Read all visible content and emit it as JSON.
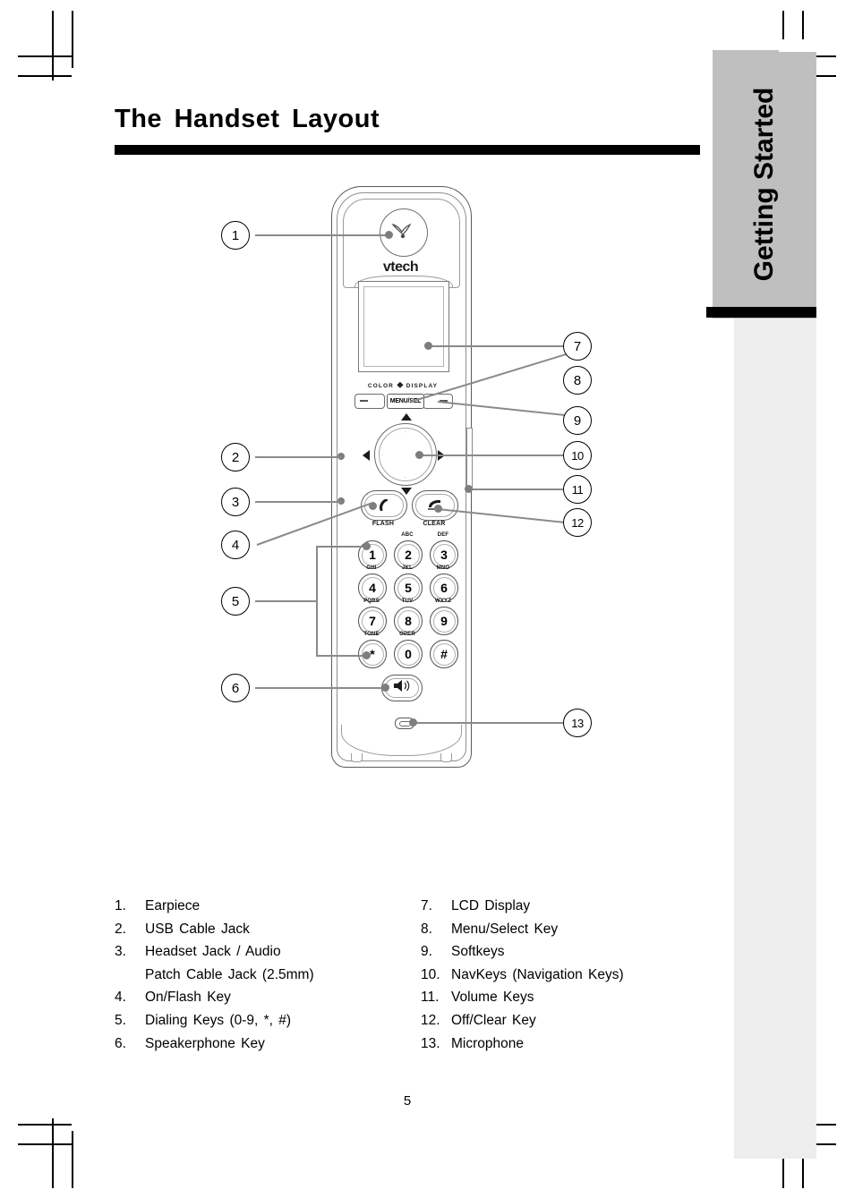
{
  "document": {
    "title": "The Handset Layout",
    "page_number": "5",
    "side_tab_label": "Getting Started"
  },
  "device": {
    "brand": "vtech",
    "display_label_prefix": "COLOR",
    "display_label_icon": "❖",
    "display_label_suffix": "DISPLAY",
    "menu_select_label": "MENU/SEL",
    "talk_key_cap": "FLASH",
    "off_key_cap": "CLEAR",
    "talk_key_glyph": "✆",
    "off_key_glyph": "✆",
    "speaker_glyph": "🔊",
    "earpiece_logo_glyph": "❧",
    "dial_keys": [
      {
        "digit": "1",
        "letters": ""
      },
      {
        "digit": "2",
        "letters": "ABC"
      },
      {
        "digit": "3",
        "letters": "DEF"
      },
      {
        "digit": "4",
        "letters": "GHI"
      },
      {
        "digit": "5",
        "letters": "JKL"
      },
      {
        "digit": "6",
        "letters": "MNO"
      },
      {
        "digit": "7",
        "letters": "PQRS"
      },
      {
        "digit": "8",
        "letters": "TUV"
      },
      {
        "digit": "9",
        "letters": "WXYZ"
      },
      {
        "digit": "*",
        "letters": "TONE"
      },
      {
        "digit": "0",
        "letters": "OPER"
      },
      {
        "digit": "#",
        "letters": ""
      }
    ]
  },
  "callouts": [
    {
      "n": "1"
    },
    {
      "n": "2"
    },
    {
      "n": "3"
    },
    {
      "n": "4"
    },
    {
      "n": "5"
    },
    {
      "n": "6"
    },
    {
      "n": "7"
    },
    {
      "n": "8"
    },
    {
      "n": "9"
    },
    {
      "n": "10"
    },
    {
      "n": "11"
    },
    {
      "n": "12"
    },
    {
      "n": "13"
    }
  ],
  "legend": {
    "left": [
      {
        "num": "1.",
        "text": "Earpiece"
      },
      {
        "num": "2.",
        "text": "USB  Cable  Jack"
      },
      {
        "num": "3.",
        "text": "Headset  Jack  /  Audio",
        "cont": "Patch  Cable  Jack  (2.5mm)"
      },
      {
        "num": "4.",
        "text": "On/Flash  Key"
      },
      {
        "num": "5.",
        "text": "Dialing  Keys  (0-9,  *,  #)"
      },
      {
        "num": "6.",
        "text": "Speakerphone  Key"
      }
    ],
    "right": [
      {
        "num": "7.",
        "text": "LCD  Display"
      },
      {
        "num": "8.",
        "text": "Menu/Select  Key"
      },
      {
        "num": "9.",
        "text": "Softkeys"
      },
      {
        "num": "10.",
        "text": "NavKeys  (Navigation  Keys)"
      },
      {
        "num": "11.",
        "text": "Volume  Keys"
      },
      {
        "num": "12.",
        "text": "Off/Clear  Key"
      },
      {
        "num": "13.",
        "text": "Microphone"
      }
    ]
  },
  "colors": {
    "tab_gray": "#bfbfbf",
    "strip_gray": "#ededed",
    "line_gray": "#8a8a8a",
    "ink": "#000000"
  }
}
